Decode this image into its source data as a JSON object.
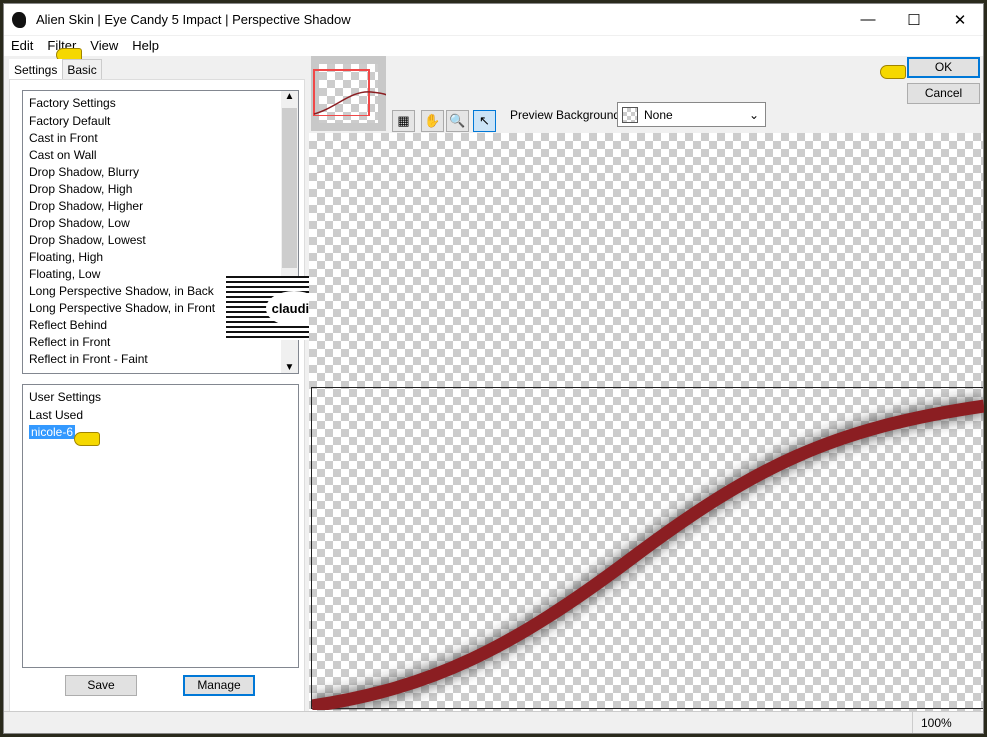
{
  "title": "Alien Skin | Eye Candy 5 Impact | Perspective Shadow",
  "menu": [
    "Edit",
    "Filter",
    "View",
    "Help"
  ],
  "tabs": [
    "Settings",
    "Basic"
  ],
  "factory": {
    "header": "Factory Settings",
    "items": [
      "Factory Default",
      "Cast in Front",
      "Cast on Wall",
      "Drop Shadow, Blurry",
      "Drop Shadow, High",
      "Drop Shadow, Higher",
      "Drop Shadow, Low",
      "Drop Shadow, Lowest",
      "Floating, High",
      "Floating, Low",
      "Long Perspective Shadow, in Back",
      "Long Perspective Shadow, in Front",
      "Reflect Behind",
      "Reflect in Front",
      "Reflect in Front - Faint"
    ]
  },
  "user": {
    "header": "User Settings",
    "items": [
      "Last Used",
      "nicole-6"
    ],
    "selected": "nicole-6"
  },
  "buttons": {
    "save": "Save",
    "manage": "Manage",
    "ok": "OK",
    "cancel": "Cancel"
  },
  "preview": {
    "label": "Preview Background:",
    "value": "None"
  },
  "watermark": "claudia",
  "status": {
    "zoom": "100%"
  },
  "colors": {
    "shadow_line": "#8b1e22",
    "selection": "#3399ff",
    "pointer": "#f5d800"
  }
}
